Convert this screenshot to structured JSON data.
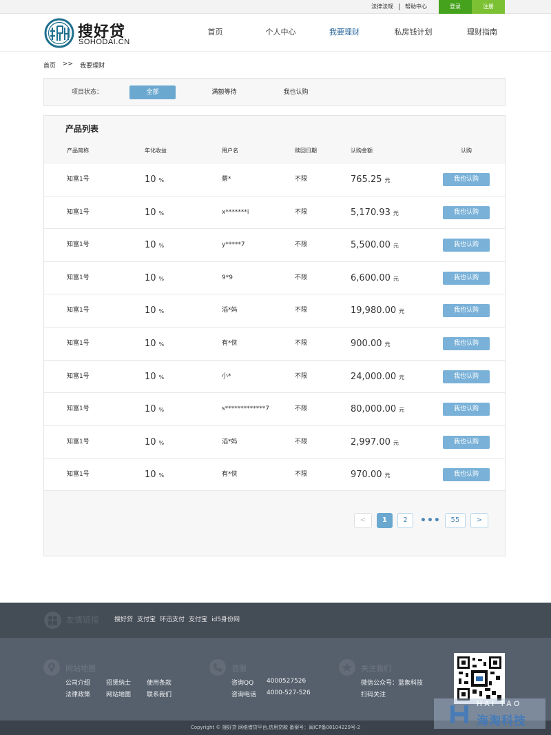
{
  "topbar": {
    "links": [
      "法律法规",
      "帮助中心"
    ],
    "login_label": "登录",
    "register_label": "注册"
  },
  "header": {
    "logo_cn": "搜好贷",
    "logo_en": "SOHODAI.CN",
    "nav": [
      {
        "label": "首页",
        "active": false
      },
      {
        "label": "个人中心",
        "active": false
      },
      {
        "label": "我要理财",
        "active": true
      },
      {
        "label": "私房钱计划",
        "active": false
      },
      {
        "label": "理财指南",
        "active": false
      }
    ]
  },
  "breadcrumb": {
    "home": "首页",
    "separator": ">>",
    "current": "我要理财"
  },
  "filter": {
    "label": "项目状态：",
    "options": [
      {
        "label": "全部",
        "active": true
      },
      {
        "label": "满额等待",
        "active": false
      },
      {
        "label": "我也认购",
        "active": false
      }
    ]
  },
  "products": {
    "title": "产品列表",
    "columns": [
      "产品简称",
      "年化收益",
      "用户名",
      "赎回日期",
      "认购金额",
      "认购"
    ],
    "rate_unit": "%",
    "amount_unit": "元",
    "buy_label": "我也认购",
    "rows": [
      {
        "name": "知富1号",
        "rate": "10",
        "user": "蔡*",
        "term": "不限",
        "amount": "765.25"
      },
      {
        "name": "知富1号",
        "rate": "10",
        "user": "x*******i",
        "term": "不限",
        "amount": "5,170.93"
      },
      {
        "name": "知富1号",
        "rate": "10",
        "user": "y*****7",
        "term": "不限",
        "amount": "5,500.00"
      },
      {
        "name": "知富1号",
        "rate": "10",
        "user": "9*9",
        "term": "不限",
        "amount": "6,600.00"
      },
      {
        "name": "知富1号",
        "rate": "10",
        "user": "滔*妈",
        "term": "不限",
        "amount": "19,980.00"
      },
      {
        "name": "知富1号",
        "rate": "10",
        "user": "有*侠",
        "term": "不限",
        "amount": "900.00"
      },
      {
        "name": "知富1号",
        "rate": "10",
        "user": "小*",
        "term": "不限",
        "amount": "24,000.00"
      },
      {
        "name": "知富1号",
        "rate": "10",
        "user": "s*************7",
        "term": "不限",
        "amount": "80,000.00"
      },
      {
        "name": "知富1号",
        "rate": "10",
        "user": "滔*妈",
        "term": "不限",
        "amount": "2,997.00"
      },
      {
        "name": "知富1号",
        "rate": "10",
        "user": "有*侠",
        "term": "不限",
        "amount": "970.00"
      }
    ]
  },
  "pagination": {
    "prev": "<",
    "pages": [
      "1",
      "2"
    ],
    "current": "1",
    "dots": "•••",
    "last": "55",
    "next": ">"
  },
  "footer": {
    "friend_title": "友情链接",
    "friend_links": [
      "搜好贷",
      "支付宝",
      "环迅支付",
      "支付宝",
      "id5身份网"
    ],
    "sitemap_title": "网站地图",
    "sitemap_links": [
      "公司介绍",
      "招贤纳士",
      "使用条款",
      "法律政策",
      "网站地图",
      "联系我们"
    ],
    "consult_title": "咨服",
    "consult_qq_label": "咨询QQ",
    "consult_qq": "4000527526",
    "consult_phone_label": "咨询电话",
    "consult_phone": "4000-527-526",
    "follow_title": "关注我们",
    "follow_wechat": "微信公众号：蓝象科技",
    "follow_scan": "扫码关注",
    "copyright": "Copyright © 搜好贷 网络借贷平台,信用贷款 备案号：闽ICP备08104229号-2"
  },
  "watermark": {
    "line1": "HAI TAO",
    "line2": "海淘科技"
  },
  "colors": {
    "accent": "#6ba8d0",
    "login": "#45a21c",
    "register": "#7cc134",
    "footer": "#56606c"
  }
}
